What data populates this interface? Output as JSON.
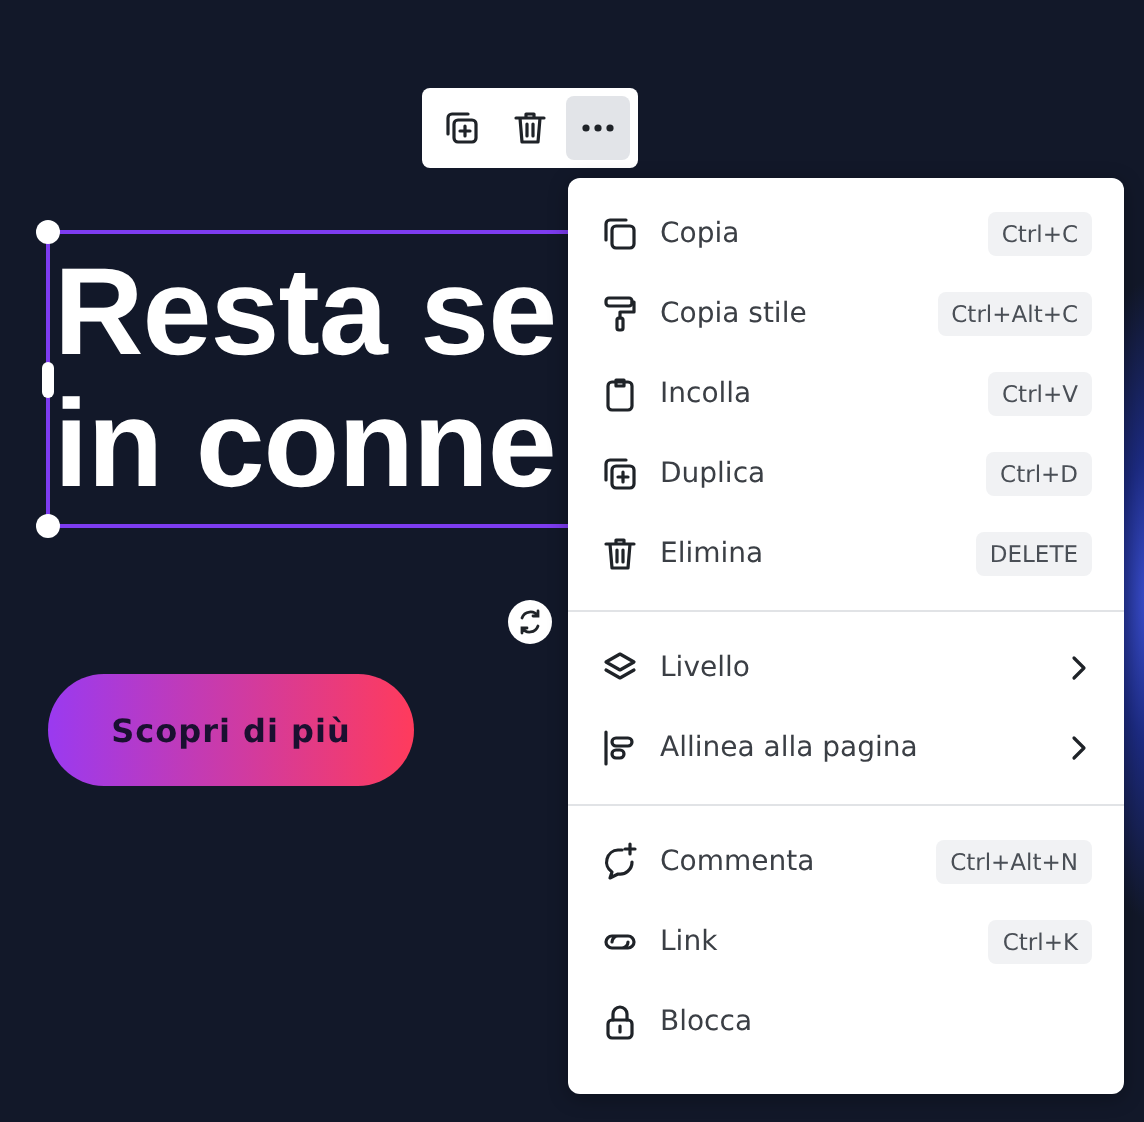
{
  "headline": {
    "lines": [
      "Resta se",
      "in conne"
    ],
    "selected": true
  },
  "cta": {
    "label": "Scopri di più"
  },
  "toolbar": [
    {
      "kind": "duplicate",
      "selected": false
    },
    {
      "kind": "delete",
      "selected": false
    },
    {
      "kind": "more",
      "selected": true
    }
  ],
  "menu": {
    "groups": [
      {
        "items": [
          {
            "label": "Copia",
            "shortcut": "Ctrl+C",
            "kind": "copy"
          },
          {
            "label": "Copia stile",
            "shortcut": "Ctrl+Alt+C",
            "kind": "paint"
          },
          {
            "label": "Incolla",
            "shortcut": "Ctrl+V",
            "kind": "paste"
          },
          {
            "label": "Duplica",
            "shortcut": "Ctrl+D",
            "kind": "duplicate"
          },
          {
            "label": "Elimina",
            "shortcut": "DELETE",
            "kind": "delete"
          }
        ]
      },
      {
        "items": [
          {
            "label": "Livello",
            "kind": "layers",
            "submenu": true
          },
          {
            "label": "Allinea alla pagina",
            "kind": "align",
            "submenu": true
          }
        ]
      },
      {
        "items": [
          {
            "label": "Commenta",
            "shortcut": "Ctrl+Alt+N",
            "kind": "comment"
          },
          {
            "label": "Link",
            "shortcut": "Ctrl+K",
            "kind": "link"
          },
          {
            "label": "Blocca",
            "kind": "lock"
          }
        ]
      }
    ]
  }
}
